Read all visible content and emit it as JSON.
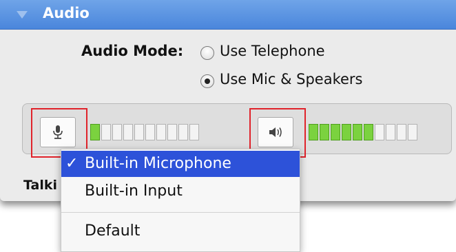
{
  "header": {
    "title": "Audio",
    "expand_icon": "disclosure-triangle-down"
  },
  "audio_mode": {
    "label": "Audio Mode:",
    "options": [
      {
        "label": "Use Telephone",
        "selected": false
      },
      {
        "label": "Use Mic & Speakers",
        "selected": true
      }
    ]
  },
  "meters": {
    "microphone": {
      "icon": "microphone-icon",
      "segments": 10,
      "active": 1
    },
    "speaker": {
      "icon": "speaker-icon",
      "segments": 10,
      "active": 6
    }
  },
  "talking_label": "Talki",
  "menu": {
    "items": [
      {
        "check": "✓",
        "label": "Built-in Microphone",
        "selected": true
      },
      {
        "check": "",
        "label": "Built-in Input",
        "selected": false
      },
      {
        "check": "",
        "label": "Default",
        "selected": false
      }
    ]
  },
  "colors": {
    "header": "#4a86dc",
    "meter_on": "#7bd23f",
    "highlight": "#e0222a",
    "menu_selected": "#2d52d9"
  }
}
